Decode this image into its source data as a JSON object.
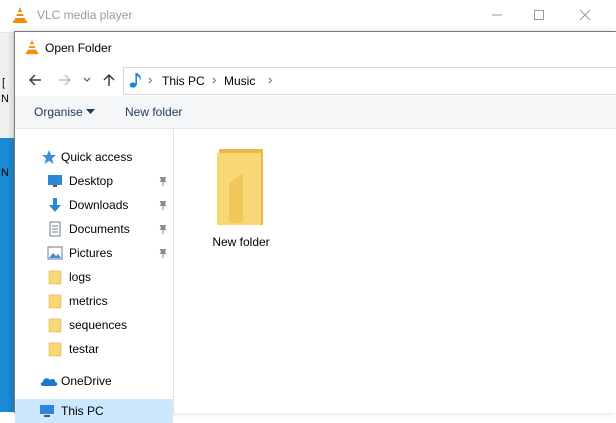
{
  "window": {
    "title": "VLC media player",
    "controls": {
      "minimize": "—",
      "maximize": "☐",
      "close": "✕"
    }
  },
  "background_fragments": [
    "[",
    "N",
    "N"
  ],
  "dialog": {
    "title": "Open Folder",
    "breadcrumbs": [
      "This PC",
      "Music"
    ],
    "toolbar": {
      "organise_label": "Organise",
      "new_folder_label": "New folder"
    },
    "nav": {
      "quick_access": "Quick access",
      "pinned": [
        "Desktop",
        "Downloads",
        "Documents",
        "Pictures"
      ],
      "folders": [
        "logs",
        "metrics",
        "sequences",
        "testar"
      ],
      "onedrive": "OneDrive",
      "this_pc": "This PC"
    },
    "items": [
      {
        "name": "New folder",
        "type": "folder"
      }
    ]
  },
  "colors": {
    "accent": "#0078d7",
    "folder": "#f8d775",
    "folder_dark": "#e8b84a",
    "vlc_orange": "#f48b00",
    "selected_bg": "#cce8ff"
  }
}
